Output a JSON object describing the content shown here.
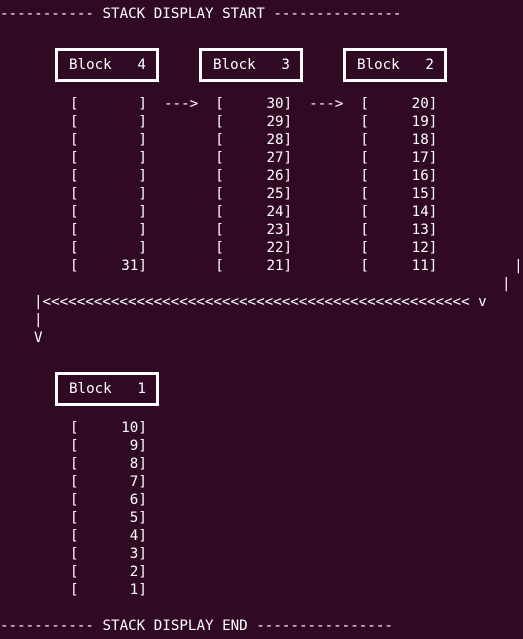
{
  "header": "----------- STACK DISPLAY START ---------------",
  "footer": "----------- STACK DISPLAY END ----------------",
  "blocks": {
    "b4": "Block   4",
    "b3": "Block   3",
    "b2": "Block   2",
    "b1": "Block   1"
  },
  "row1_lines": [
    "[       ]  --->  [     30]  --->  [     20]",
    "[       ]        [     29]        [     19]",
    "[       ]        [     28]        [     18]",
    "[       ]        [     27]        [     17]",
    "[       ]        [     26]        [     16]",
    "[       ]        [     25]        [     15]",
    "[       ]        [     24]        [     14]",
    "[       ]        [     23]        [     13]",
    "[       ]        [     22]        [     12]",
    "[     31]        [     21]        [     11]         |"
  ],
  "connector_lines": [
    "|",
    "|<<<<<<<<<<<<<<<<<<<<<<<<<<<<<<<<<<<<<<<<<<<<<<<<<< v",
    "|",
    "V"
  ],
  "row2_lines": [
    "[     10]",
    "[      9]",
    "[      8]",
    "[      7]",
    "[      6]",
    "[      5]",
    "[      4]",
    "[      3]",
    "[      2]",
    "[      1]"
  ]
}
